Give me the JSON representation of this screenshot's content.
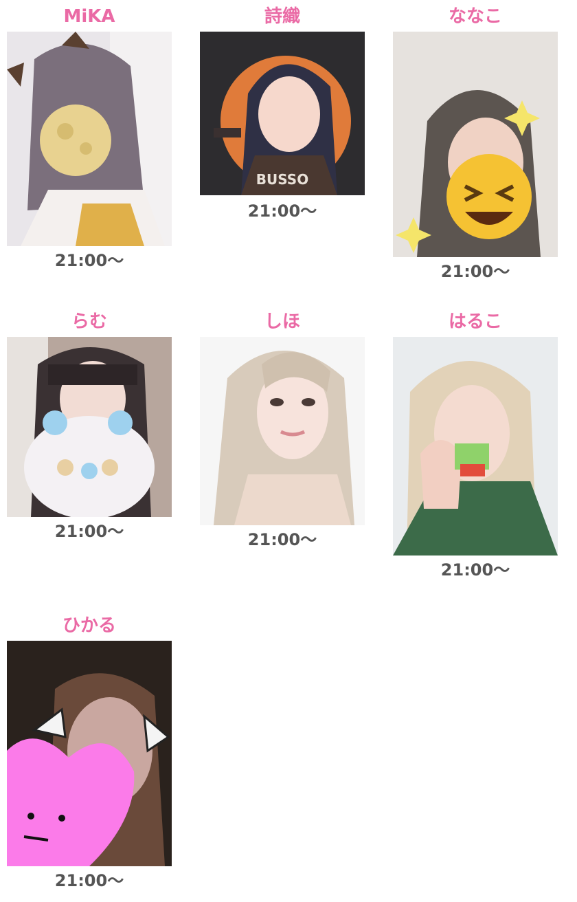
{
  "cast": [
    {
      "name": "MiKA",
      "time": "21:00〜"
    },
    {
      "name": "詩織",
      "time": "21:00〜",
      "photo_text": "BUSSO"
    },
    {
      "name": "ななこ",
      "time": "21:00〜"
    },
    {
      "name": "らむ",
      "time": "21:00〜"
    },
    {
      "name": "しほ",
      "time": "21:00〜"
    },
    {
      "name": "はるこ",
      "time": "21:00〜"
    },
    {
      "name": "ひかる",
      "time": "21:00〜"
    }
  ],
  "colors": {
    "name": "#ea6aa5",
    "time": "#555555",
    "background": "#ffffff"
  }
}
